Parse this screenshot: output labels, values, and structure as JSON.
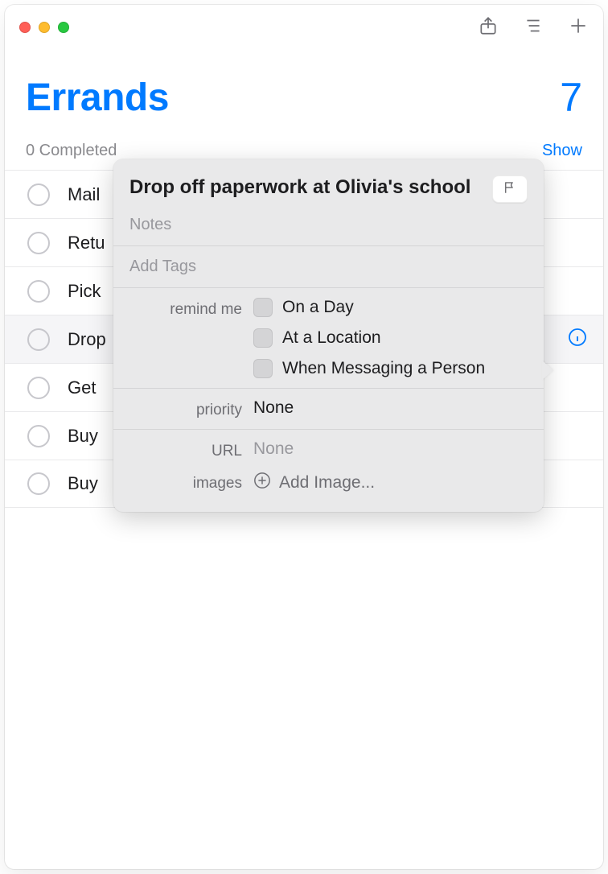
{
  "header": {
    "title": "Errands",
    "count": "7"
  },
  "subheader": {
    "completed": "0 Completed",
    "show_label": "Show"
  },
  "list": {
    "items": [
      {
        "title": "Mail"
      },
      {
        "title": "Retu"
      },
      {
        "title": "Pick"
      },
      {
        "title": "Drop"
      },
      {
        "title": "Get"
      },
      {
        "title": "Buy"
      },
      {
        "title": "Buy"
      }
    ]
  },
  "popover": {
    "title": "Drop off paperwork at Olivia's school",
    "notes_placeholder": "Notes",
    "tags_placeholder": "Add Tags",
    "remind_me_label": "remind me",
    "options": {
      "on_day": "On a Day",
      "at_location": "At a Location",
      "when_messaging": "When Messaging a Person"
    },
    "priority_label": "priority",
    "priority_value": "None",
    "url_label": "URL",
    "url_value": "None",
    "images_label": "images",
    "add_image_label": "Add Image..."
  }
}
